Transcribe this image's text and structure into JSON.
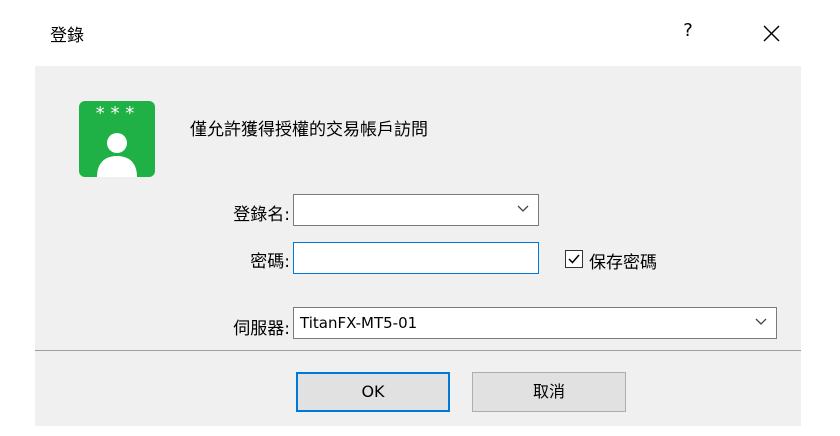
{
  "window": {
    "title": "登錄",
    "help_label": "?"
  },
  "avatar": {
    "stars": "***"
  },
  "message": "僅允許獲得授權的交易帳戶訪問",
  "login": {
    "label": "登錄名:",
    "value": ""
  },
  "password": {
    "label": "密碼:",
    "value": ""
  },
  "save_password": {
    "label": "保存密碼",
    "checked": true
  },
  "server": {
    "label": "伺服器:",
    "value": "TitanFX-MT5-01"
  },
  "buttons": {
    "ok": "OK",
    "cancel": "取消"
  },
  "colors": {
    "avatar_green": "#1fb145",
    "focus_blue": "#0078d7"
  }
}
